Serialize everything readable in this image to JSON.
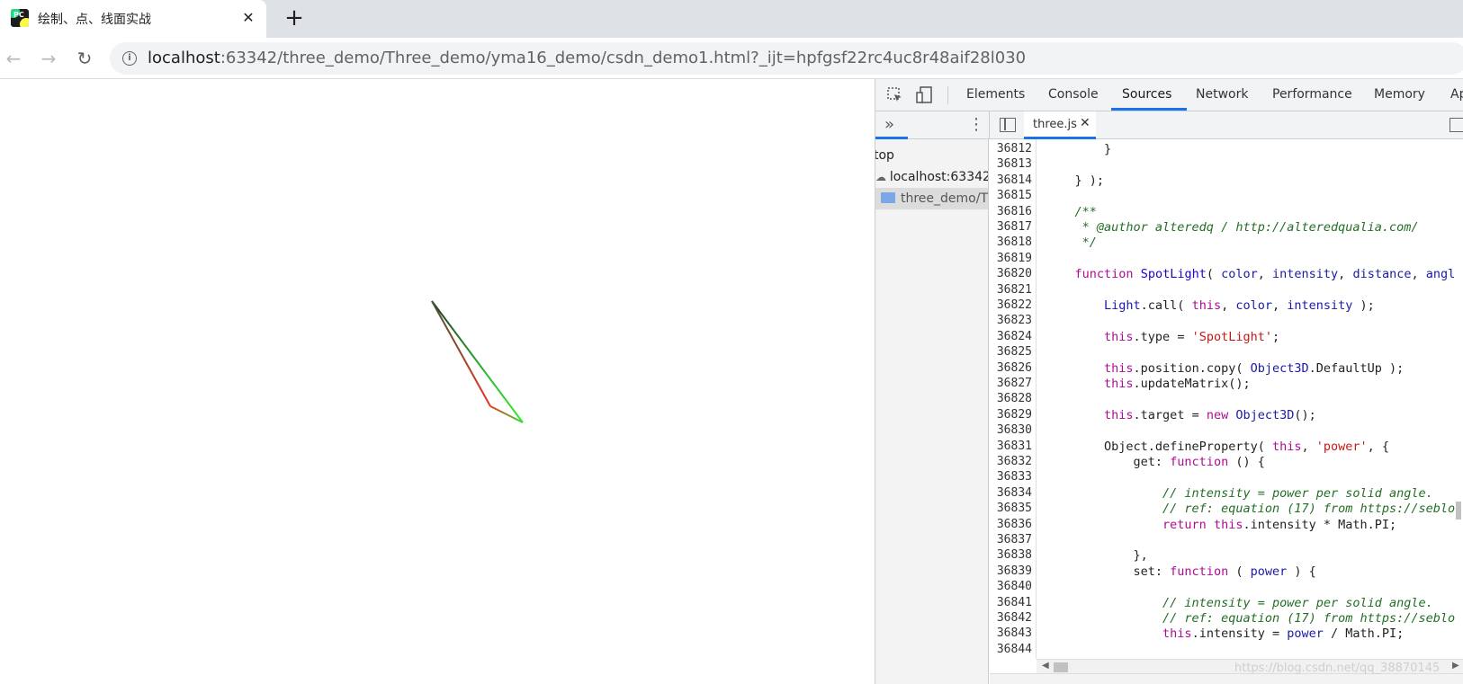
{
  "browser": {
    "tab_title": "绘制、点、线面实战",
    "tab_favicon_text": "PC",
    "tab_close_glyph": "✕",
    "new_tab_glyph": "+",
    "url_host": "localhost",
    "url_rest": ":63342/three_demo/Three_demo/yma16_demo/csdn_demo1.html?_ijt=hpfgsf22rc4uc8r48aif28l030"
  },
  "devtools": {
    "tabs": [
      "Elements",
      "Console",
      "Sources",
      "Network",
      "Performance",
      "Memory",
      "Ap"
    ],
    "active_tab": "Sources",
    "file_tab": "three.js",
    "navigator": [
      "top",
      "localhost:63342",
      "three_demo/Th"
    ],
    "code_lines": [
      {
        "num": "36812",
        "html": "        }"
      },
      {
        "num": "36813",
        "html": ""
      },
      {
        "num": "36814",
        "html": "    } );"
      },
      {
        "num": "36815",
        "html": ""
      },
      {
        "num": "36816",
        "html": "    <span class=\"cm\">/**</span>"
      },
      {
        "num": "36817",
        "html": "<span class=\"cm\">     * @author alteredq / http://alteredqualia.com/</span>"
      },
      {
        "num": "36818",
        "html": "<span class=\"cm\">     */</span>"
      },
      {
        "num": "36819",
        "html": ""
      },
      {
        "num": "36820",
        "html": "    <span class=\"kw\">function</span> <span class=\"fn\">SpotLight</span>( <span class=\"id\">color</span>, <span class=\"id\">intensity</span>, <span class=\"id\">distance</span>, <span class=\"id\">angl</span>"
      },
      {
        "num": "36821",
        "html": ""
      },
      {
        "num": "36822",
        "html": "        <span class=\"id\">Light</span>.call( <span class=\"kw\">this</span>, <span class=\"id\">color</span>, <span class=\"id\">intensity</span> );"
      },
      {
        "num": "36823",
        "html": ""
      },
      {
        "num": "36824",
        "html": "        <span class=\"kw\">this</span>.type = <span class=\"str\">'SpotLight'</span>;"
      },
      {
        "num": "36825",
        "html": ""
      },
      {
        "num": "36826",
        "html": "        <span class=\"kw\">this</span>.position.copy( <span class=\"id\">Object3D</span>.DefaultUp );"
      },
      {
        "num": "36827",
        "html": "        <span class=\"kw\">this</span>.updateMatrix();"
      },
      {
        "num": "36828",
        "html": ""
      },
      {
        "num": "36829",
        "html": "        <span class=\"kw\">this</span>.target = <span class=\"kw\">new</span> <span class=\"id\">Object3D</span>();"
      },
      {
        "num": "36830",
        "html": ""
      },
      {
        "num": "36831",
        "html": "        Object.defineProperty( <span class=\"kw\">this</span>, <span class=\"str\">'power'</span>, {"
      },
      {
        "num": "36832",
        "html": "            get: <span class=\"kw\">function</span> () {"
      },
      {
        "num": "36833",
        "html": ""
      },
      {
        "num": "36834",
        "html": "<span class=\"cm\">                // intensity = power per solid angle.</span>"
      },
      {
        "num": "36835",
        "html": "<span class=\"cm\">                // ref: equation (17) from https://seblo</span>"
      },
      {
        "num": "36836",
        "html": "                <span class=\"kw\">return</span> <span class=\"kw\">this</span>.intensity * Math.PI;"
      },
      {
        "num": "36837",
        "html": ""
      },
      {
        "num": "36838",
        "html": "            },"
      },
      {
        "num": "36839",
        "html": "            set: <span class=\"kw\">function</span> ( <span class=\"id\">power</span> ) {"
      },
      {
        "num": "36840",
        "html": ""
      },
      {
        "num": "36841",
        "html": "<span class=\"cm\">                // intensity = power per solid angle.</span>"
      },
      {
        "num": "36842",
        "html": "<span class=\"cm\">                // ref: equation (17) from https://seblo</span>"
      },
      {
        "num": "36843",
        "html": "                <span class=\"kw\">this</span>.intensity = <span class=\"id\">power</span> / Math.PI;"
      },
      {
        "num": "36844",
        "html": ""
      }
    ]
  },
  "watermark": "https://blog.csdn.net/qq_38870145",
  "colors": {
    "accent": "#1a73e8",
    "line_green": "#33dd33",
    "line_red": "#ee3322",
    "line_dark": "#334433"
  }
}
